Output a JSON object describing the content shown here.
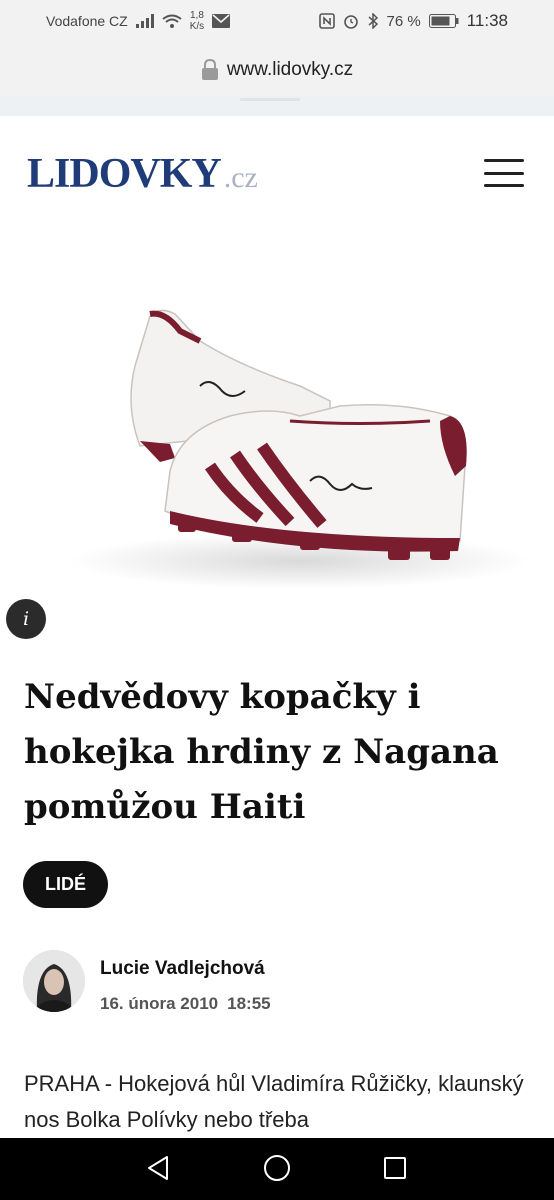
{
  "status_bar": {
    "carrier": "Vodafone CZ",
    "speed_value": "1,8",
    "speed_unit": "K/s",
    "battery": "76 %",
    "time": "11:38"
  },
  "browser": {
    "url": "www.lidovky.cz"
  },
  "site": {
    "logo_main": "LIDOVKY",
    "logo_suffix": ".cz",
    "brand_color": "#1f3b78"
  },
  "article": {
    "headline": "Nedvědovy kopačky i hokejka hrdiny z Nagana pomůžou Haiti",
    "category": "LIDÉ",
    "author": "Lucie Vadlejchová",
    "date": "16. února 2010",
    "time": "18:55",
    "body_preview": "PRAHA - Hokejová hůl Vladimíra Růžičky, klaunský nos Bolka Polívky nebo třeba",
    "image_info_label": "i"
  },
  "icons": {
    "menu": "hamburger-icon",
    "info": "info-icon",
    "lock": "lock-icon",
    "back": "back-triangle-icon",
    "home": "home-circle-icon",
    "recents": "recents-square-icon"
  }
}
